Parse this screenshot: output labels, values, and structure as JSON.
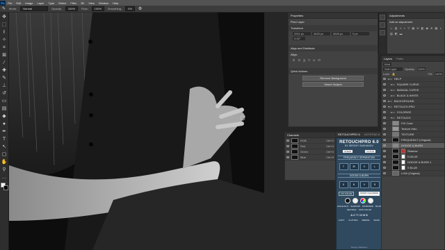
{
  "menu": {
    "ps": "Ps",
    "items": [
      "File",
      "Edit",
      "Image",
      "Layer",
      "Type",
      "Select",
      "Filter",
      "3D",
      "View",
      "Window",
      "Help"
    ]
  },
  "options": {
    "mode_label": "Mode:",
    "mode": "Normal",
    "opacity_label": "Opacity:",
    "opacity": "100%",
    "flow_label": "Flow:",
    "flow": "100%",
    "smoothing_label": "Smoothing:",
    "smoothing": "0%"
  },
  "properties": {
    "tab": "Properties",
    "pixel_layer": "Pixel Layer",
    "transform": "Transform",
    "w": "2911 px",
    "h": "3420 px",
    "x": "3640 px",
    "y": "0 px",
    "angle": "0.00°",
    "align": "Align and Distribute",
    "align_sub": "Align:",
    "quick": "Quick Actions",
    "btn1": "Remove Background",
    "btn2": "Select Subject"
  },
  "adjustments": {
    "tab": "Adjustments",
    "sub": "Add an adjustment"
  },
  "channels": {
    "tab": "Channels",
    "rows": [
      {
        "name": "RGB",
        "key": "Ctrl+2"
      },
      {
        "name": "Red",
        "key": "Ctrl+3"
      },
      {
        "name": "Green",
        "key": "Ctrl+4"
      },
      {
        "name": "Blue",
        "key": "Ctrl+5"
      }
    ]
  },
  "retouch": {
    "tab1": "RETOUCHPRO 6",
    "tab2": "NOTEPAD 6",
    "title": "RETOUCHPRO 6.0",
    "sub": "BY SERGEY SUKHANOV",
    "clean": "CLEAN",
    "cloud": "CLOUD",
    "freq": "FREQUENCY SEPARATION",
    "cells": [
      "T",
      "30",
      "0",
      "L",
      "S"
    ],
    "cell_labels": [
      "TEXTURE",
      "30",
      "OFF",
      "LOW",
      "SMOOTH"
    ],
    "dodge": "DODGE & BURN",
    "dcells": [
      "D",
      "B",
      "V",
      "R",
      "V"
    ],
    "fix": "FIX COLOR",
    "start": "START COLORIZE",
    "bottom": [
      "HIGHLIGHT",
      "SHADOW",
      "DOWNSIZE",
      "BLUR",
      "NEUTRAL",
      "SKIN COLOR"
    ],
    "actions": "A C T I O N S",
    "tags": [
      "COPY",
      "FLATTEN",
      "MERGE",
      "MASK"
    ],
    "footer": "Sergey Sukhanov"
  },
  "layers": {
    "tab1": "Layers",
    "tab2": "Paths",
    "kind": "Kind",
    "blend": "Soft Light",
    "opacity_label": "Opacity:",
    "opacity": "100%",
    "lock": "Lock:",
    "fill_label": "Fill:",
    "fill": "100%",
    "rows": [
      {
        "name": "HELP"
      },
      {
        "name": "SQUARE CURVE"
      },
      {
        "name": "MANUAL CURVE"
      },
      {
        "name": "BLACK & WHITE"
      },
      {
        "name": "BACKGROUND"
      },
      {
        "name": "RETOUCH-PRO"
      },
      {
        "name": "COLORIZE"
      },
      {
        "name": "RETOUCH"
      },
      {
        "name": "FIX Color"
      },
      {
        "name": "Texture Halo"
      },
      {
        "name": "TEXTURE"
      },
      {
        "name": "FREQUENCY (Original)"
      },
      {
        "name": "DODGE & BURN"
      },
      {
        "name": "Shadow"
      },
      {
        "name": "D-BLUE"
      },
      {
        "name": "DODGE & BURN 1"
      },
      {
        "name": "S BLUE"
      },
      {
        "name": "LOW (Original)"
      }
    ]
  }
}
